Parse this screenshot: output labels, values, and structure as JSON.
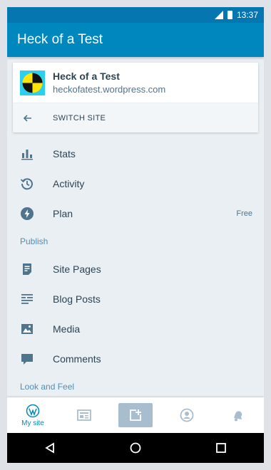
{
  "statusbar": {
    "time": "13:37"
  },
  "appbar": {
    "title": "Heck of a Test"
  },
  "site": {
    "name": "Heck of a Test",
    "url": "heckofatest.wordpress.com",
    "switch_label": "SWITCH SITE"
  },
  "menu": {
    "stats": "Stats",
    "activity": "Activity",
    "plan": "Plan",
    "plan_badge": "Free",
    "publish_header": "Publish",
    "site_pages": "Site Pages",
    "blog_posts": "Blog Posts",
    "media": "Media",
    "comments": "Comments",
    "look_header": "Look and Feel"
  },
  "bottomnav": {
    "mysite_label": "My site"
  },
  "colors": {
    "primary": "#0087be",
    "statusbar": "#0676b1",
    "text": "#2e4453",
    "icon": "#4f748e",
    "section": "#4f8fb8"
  },
  "icons": [
    "stats-icon",
    "activity-icon",
    "plan-icon",
    "site-pages-icon",
    "blog-posts-icon",
    "media-icon",
    "comments-icon",
    "wordpress-icon",
    "reader-icon",
    "write-icon",
    "me-icon",
    "notifications-icon",
    "back-icon",
    "home-icon",
    "recents-icon"
  ]
}
